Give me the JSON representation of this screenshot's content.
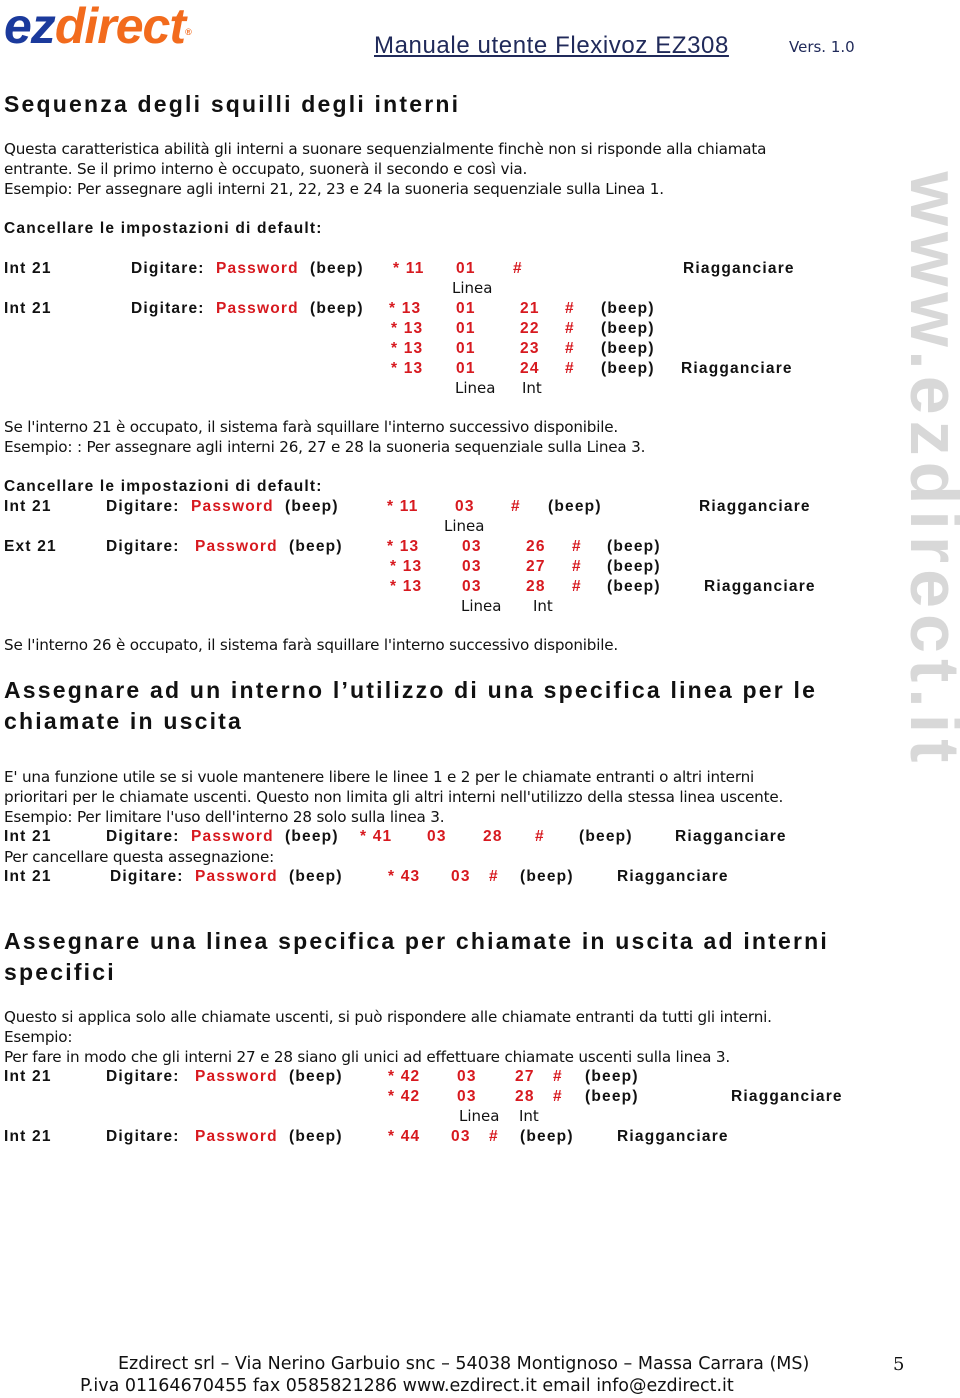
{
  "header": {
    "logo_ez": "ez",
    "logo_direct": "direct",
    "logo_reg": "®",
    "manual_title": "Manuale utente Flexivoz EZ308",
    "version": "Vers. 1.0"
  },
  "watermark": "www.ezdirect.it",
  "colors": {
    "accent_red": "#d7191f",
    "logo_blue": "#1b3a9c",
    "logo_orange": "#f26b1d"
  },
  "section1": {
    "title": "Sequenza degli squilli degli interni",
    "intro": [
      "Questa caratteristica abilità gli interni a suonare sequenzialmente finchè non si risponde alla chiamata",
      "entrante. Se il primo interno è occupato, suonerà il secondo e così via.",
      "Esempio: Per assegnare agli interni 21, 22, 23 e 24 la suoneria sequenziale sulla Linea 1."
    ],
    "cancel_defaults": "Cancellare le impostazioni di default:",
    "example1": {
      "row1": {
        "ext": "Int 21",
        "digit": "Digitare:",
        "password": "Password",
        "beep": "(beep)",
        "code": "* 11",
        "line": "01",
        "hash": "#",
        "hangup": "Riagganciare",
        "label_line": "Linea"
      },
      "row2": {
        "ext": "Int 21",
        "digit": "Digitare:",
        "password": "Password",
        "beep": "(beep)"
      },
      "seq": [
        {
          "code": "* 13",
          "line": "01",
          "int": "21",
          "hash": "#",
          "beep": "(beep)",
          "hangup": ""
        },
        {
          "code": "* 13",
          "line": "01",
          "int": "22",
          "hash": "#",
          "beep": "(beep)",
          "hangup": ""
        },
        {
          "code": "* 13",
          "line": "01",
          "int": "23",
          "hash": "#",
          "beep": "(beep)",
          "hangup": ""
        },
        {
          "code": "* 13",
          "line": "01",
          "int": "24",
          "hash": "#",
          "beep": "(beep)",
          "hangup": "Riagganciare"
        }
      ],
      "label_line": "Linea",
      "label_int": "Int"
    },
    "note1": "Se l'interno 21 è occupato, il sistema farà squillare l'interno successivo disponibile.",
    "example2_intro": "Esempio: : Per assegnare agli interni 26, 27 e 28 la suoneria sequenziale sulla Linea 3.",
    "cancel_defaults2": "Cancellare le impostazioni di default:",
    "example2": {
      "row1": {
        "ext": "Int 21",
        "digit": "Digitare:",
        "password": "Password",
        "beep": "(beep)",
        "code": "* 11",
        "line": "03",
        "hash": "#",
        "beep2": "(beep)",
        "hangup": "Riagganciare",
        "label_line": "Linea"
      },
      "row2": {
        "ext": "Ext 21",
        "digit": "Digitare:",
        "password": "Password",
        "beep": "(beep)"
      },
      "seq": [
        {
          "code": "* 13",
          "line": "03",
          "int": "26",
          "hash": "#",
          "beep": "(beep)",
          "hangup": ""
        },
        {
          "code": "* 13",
          "line": "03",
          "int": "27",
          "hash": "#",
          "beep": "(beep)",
          "hangup": ""
        },
        {
          "code": "* 13",
          "line": "03",
          "int": "28",
          "hash": "#",
          "beep": "(beep)",
          "hangup": "Riagganciare"
        }
      ],
      "label_line": "Linea",
      "label_int": "Int"
    },
    "note2": "Se l'interno 26 è occupato, il sistema farà squillare l'interno successivo disponibile."
  },
  "section2": {
    "title_line1": "Assegnare ad un interno l’utilizzo di una specifica linea per le",
    "title_line2": "chiamate in uscita",
    "body": [
      "E' una funzione utile se si vuole mantenere libere le linee 1 e 2 per le chiamate entranti o altri interni",
      "prioritari per le chiamate uscenti. Questo non limita gli altri interni nell'utilizzo della stessa linea uscente.",
      "Esempio: Per limitare l'uso dell'interno 28 solo sulla linea 3."
    ],
    "cmd1": {
      "ext": "Int 21",
      "digit": "Digitare:",
      "password": "Password",
      "beep": "(beep)",
      "code": "* 41",
      "line": "03",
      "int": "28",
      "hash": "#",
      "beep2": "(beep)",
      "hangup": "Riagganciare"
    },
    "cancel_label": "Per cancellare questa assegnazione:",
    "cmd2": {
      "ext": "Int 21",
      "digit": "Digitare:",
      "password": "Password",
      "beep": "(beep)",
      "code": "* 43",
      "line": "03",
      "hash": "#",
      "beep2": "(beep)",
      "hangup": "Riagganciare"
    }
  },
  "section3": {
    "title_line1": "Assegnare una linea specifica per chiamate in uscita ad interni",
    "title_line2": "specifici",
    "body": [
      "Questo si applica solo alle chiamate uscenti, si può rispondere alle chiamate entranti da tutti gli interni.",
      "Esempio:",
      "Per fare in modo che gli interni 27 e 28 siano gli unici ad effettuare chiamate uscenti sulla linea 3."
    ],
    "cmd1": {
      "ext": "Int 21",
      "digit": "Digitare:",
      "password": "Password",
      "beep": "(beep)"
    },
    "seq": [
      {
        "code": "* 42",
        "line": "03",
        "int": "27",
        "hash": "#",
        "beep": "(beep)",
        "hangup": ""
      },
      {
        "code": "* 42",
        "line": "03",
        "int": "28",
        "hash": "#",
        "beep": "(beep)",
        "hangup": "Riagganciare"
      }
    ],
    "label_line": "Linea",
    "label_int": "Int",
    "cmd2": {
      "ext": "Int 21",
      "digit": "Digitare:",
      "password": "Password",
      "beep": "(beep)",
      "code": "* 44",
      "line": "03",
      "hash": "#",
      "beep2": "(beep)",
      "hangup": "Riagganciare"
    }
  },
  "footer": {
    "line1": "Ezdirect srl – Via Nerino Garbuio snc – 54038 Montignoso – Massa Carrara (MS)",
    "line2": "P.iva 01164670455  fax 0585821286  www.ezdirect.it  email info@ezdirect.it",
    "page_number": "5"
  }
}
